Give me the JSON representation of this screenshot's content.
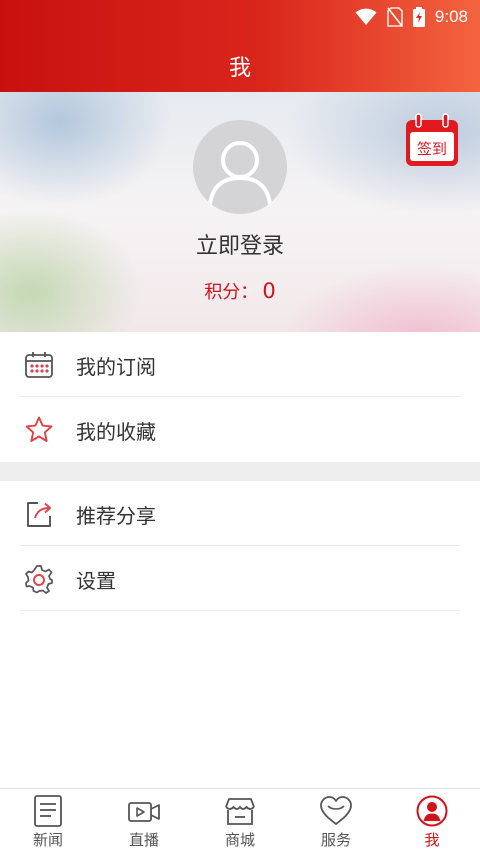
{
  "status": {
    "time": "9:08"
  },
  "header": {
    "title": "我"
  },
  "profile": {
    "login_label": "立即登录",
    "points_label": "积分：",
    "points_value": "0",
    "checkin_label": "签到"
  },
  "menu": {
    "group1": [
      {
        "label": "我的订阅",
        "icon": "calendar-icon"
      },
      {
        "label": "我的收藏",
        "icon": "star-icon"
      }
    ],
    "group2": [
      {
        "label": "推荐分享",
        "icon": "share-icon"
      },
      {
        "label": "设置",
        "icon": "gear-icon"
      }
    ]
  },
  "tabs": [
    {
      "label": "新闻",
      "icon": "news-icon"
    },
    {
      "label": "直播",
      "icon": "live-icon"
    },
    {
      "label": "商城",
      "icon": "store-icon"
    },
    {
      "label": "服务",
      "icon": "heart-icon"
    },
    {
      "label": "我",
      "icon": "profile-icon",
      "active": true
    }
  ],
  "colors": {
    "accent": "#d0121a",
    "header_start": "#c8110f",
    "header_end": "#f4643f"
  }
}
